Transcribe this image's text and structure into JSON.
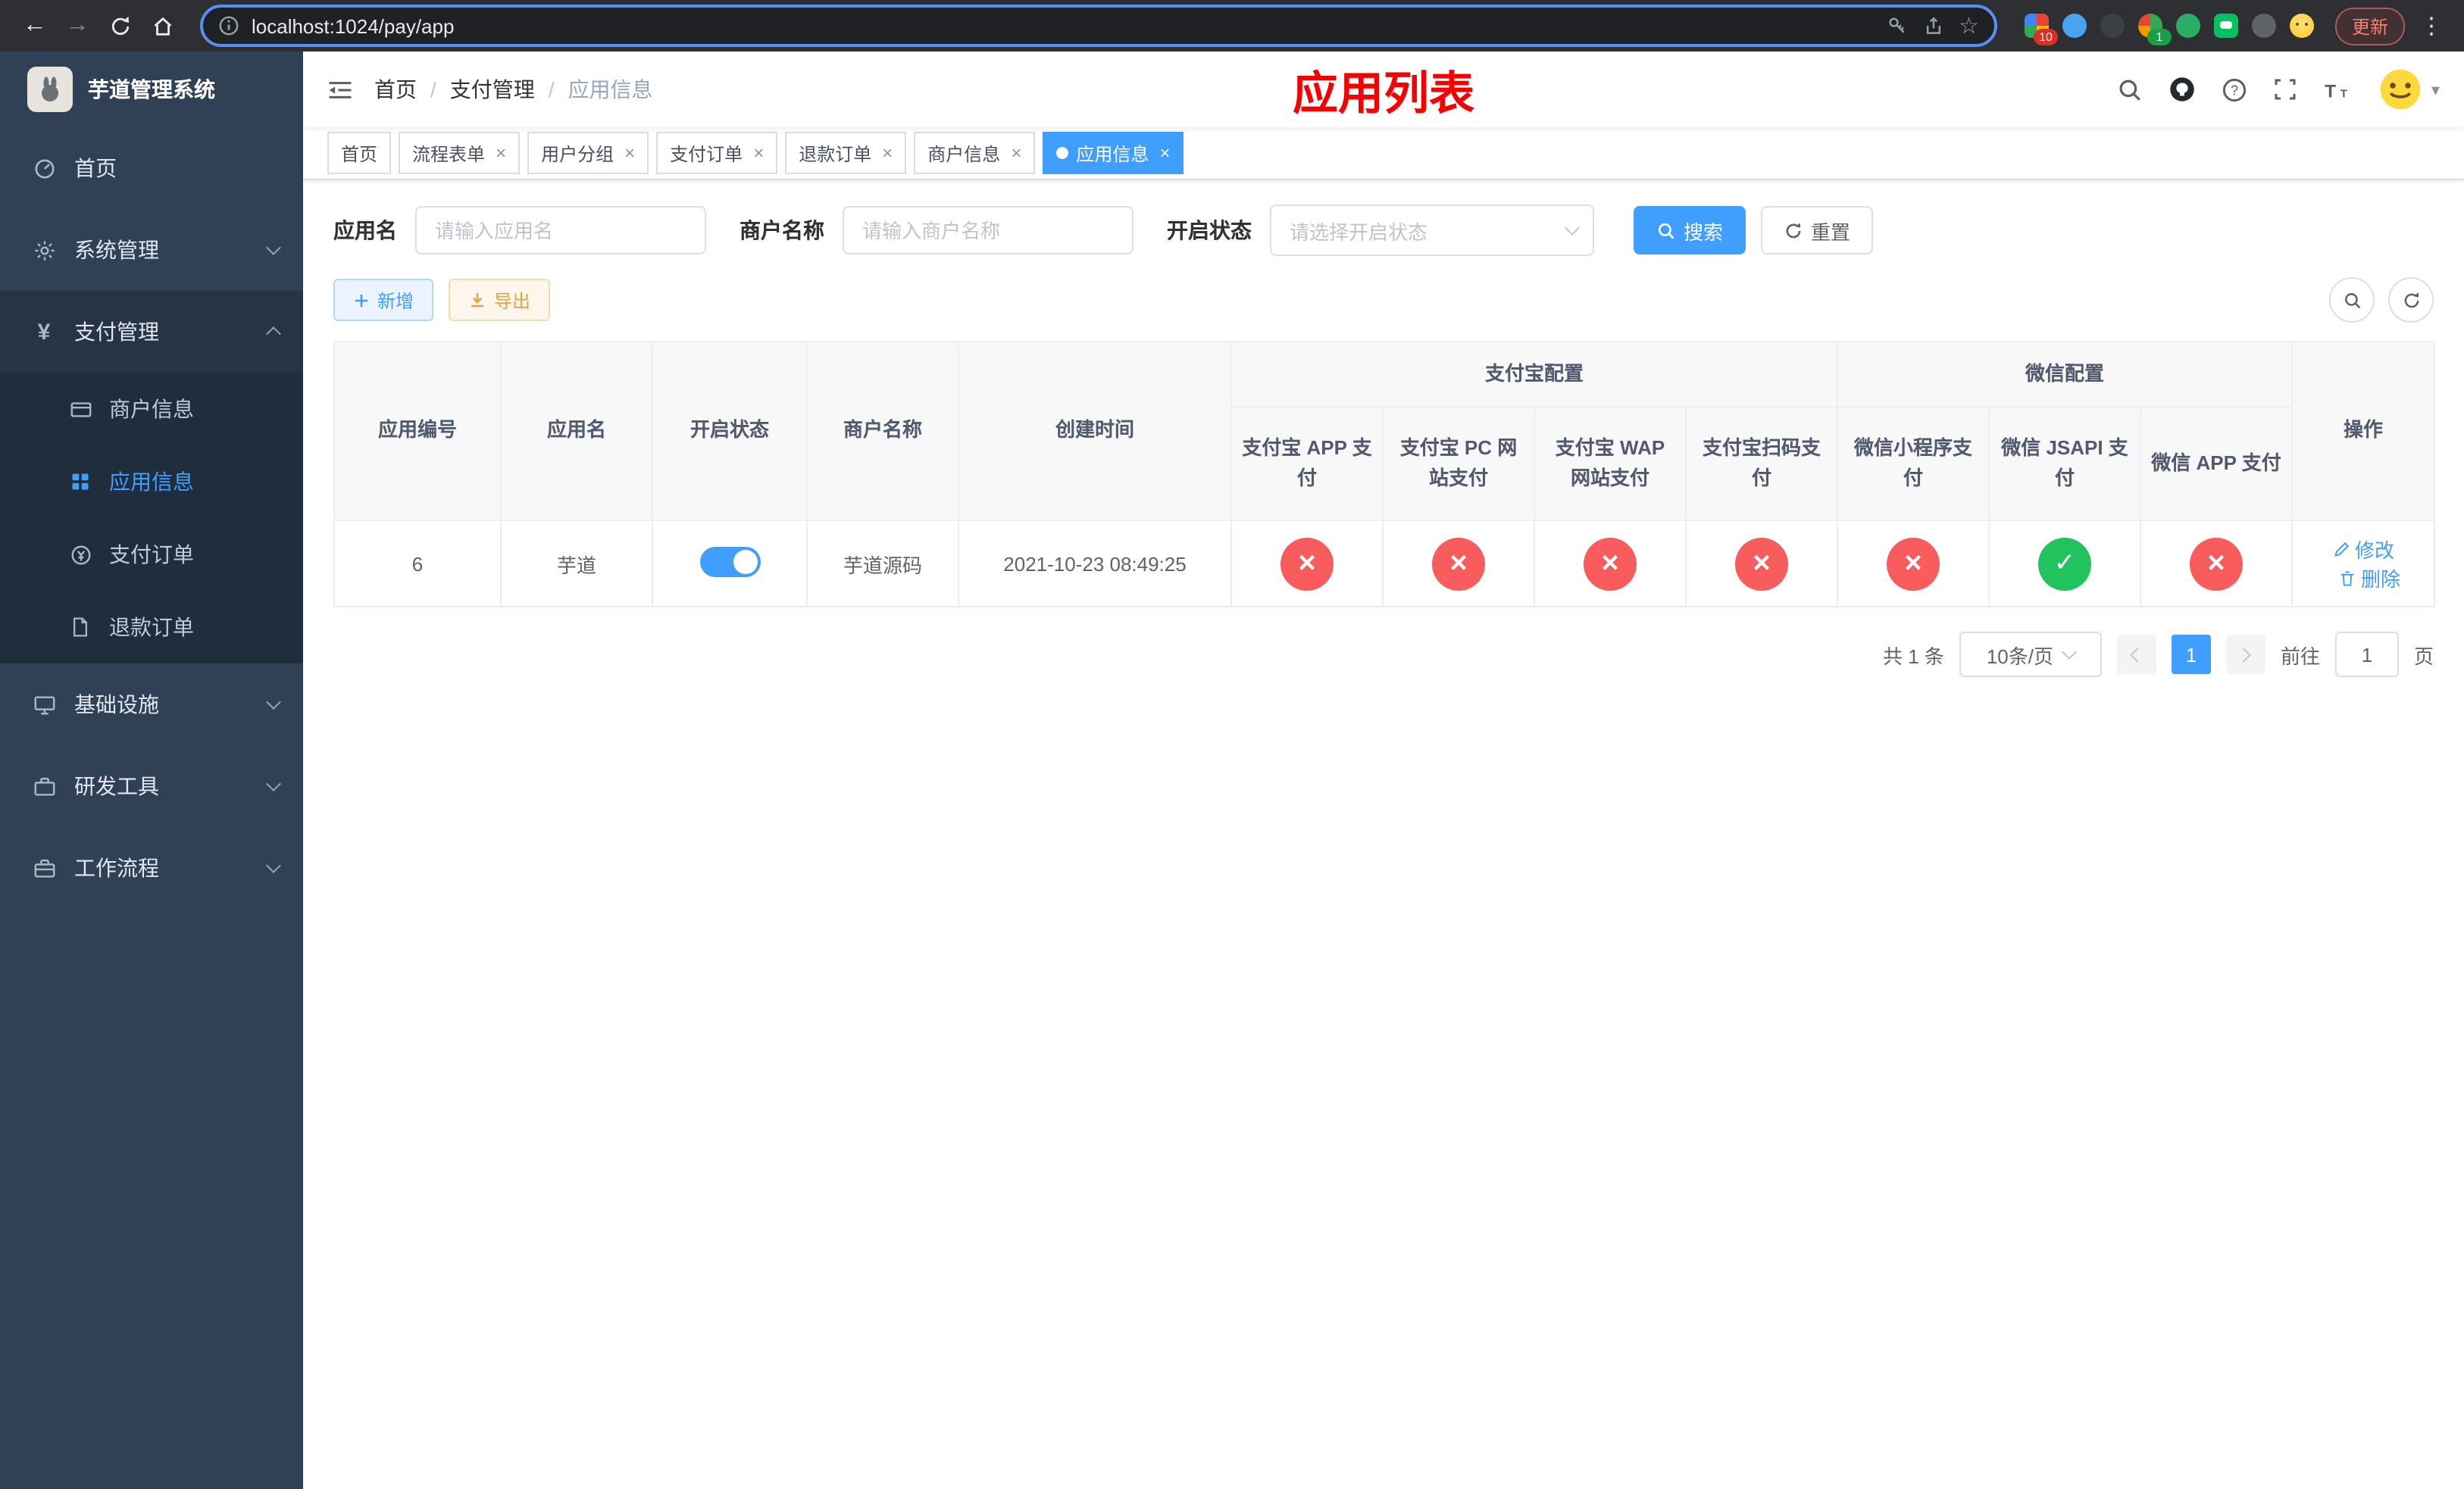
{
  "browser": {
    "url": "localhost:1024/pay/app",
    "update_label": "更新",
    "ext_badge_tabs": "10",
    "ext_badge_green": "1"
  },
  "icons": {
    "back": "←",
    "forward": "→",
    "star": "☆",
    "kebab": "⋮",
    "close": "×",
    "caret_down": "▾",
    "cross": "×",
    "check": "✓",
    "yen": "¥"
  },
  "sidebar": {
    "app_title": "芋道管理系统",
    "items": {
      "home": "首页",
      "system": "系统管理",
      "payment": "支付管理",
      "merchant_info": "商户信息",
      "app_info": "应用信息",
      "pay_order": "支付订单",
      "refund_order": "退款订单",
      "infra": "基础设施",
      "dev_tools": "研发工具",
      "workflow": "工作流程"
    }
  },
  "navbar": {
    "breadcrumb": [
      "首页",
      "支付管理",
      "应用信息"
    ],
    "separator": "/",
    "page_title": "应用列表"
  },
  "tags": [
    {
      "label": "首页"
    },
    {
      "label": "流程表单"
    },
    {
      "label": "用户分组"
    },
    {
      "label": "支付订单"
    },
    {
      "label": "退款订单"
    },
    {
      "label": "商户信息"
    },
    {
      "label": "应用信息"
    }
  ],
  "filters": {
    "app_name_label": "应用名",
    "app_name_placeholder": "请输入应用名",
    "merchant_label": "商户名称",
    "merchant_placeholder": "请输入商户名称",
    "status_label": "开启状态",
    "status_placeholder": "请选择开启状态",
    "search_label": "搜索",
    "reset_label": "重置"
  },
  "toolbar": {
    "add_label": "新增",
    "export_label": "导出"
  },
  "table": {
    "headers": {
      "app_id": "应用编号",
      "app_name": "应用名",
      "status": "开启状态",
      "merchant": "商户名称",
      "created": "创建时间",
      "alipay_group": "支付宝配置",
      "wechat_group": "微信配置",
      "alipay_app": "支付宝 APP 支付",
      "alipay_pc": "支付宝 PC 网站支付",
      "alipay_wap": "支付宝 WAP 网站支付",
      "alipay_qr": "支付宝扫码支付",
      "wx_lite": "微信小程序支付",
      "wx_jsapi": "微信 JSAPI 支付",
      "wx_app": "微信 APP 支付",
      "actions": "操作"
    },
    "row": {
      "app_id": "6",
      "app_name": "芋道",
      "enabled": true,
      "merchant": "芋道源码",
      "created": "2021-10-23 08:49:25",
      "alipay_app": "disabled",
      "alipay_pc": "disabled",
      "alipay_wap": "disabled",
      "alipay_qr": "disabled",
      "wx_lite": "disabled",
      "wx_jsapi": "enabled",
      "wx_app": "disabled",
      "edit_label": "修改",
      "delete_label": "删除"
    }
  },
  "pagination": {
    "total_text": "共 1 条",
    "page_size": "10条/页",
    "page": "1",
    "goto_label": "前往",
    "goto_value": "1",
    "page_unit": "页"
  }
}
